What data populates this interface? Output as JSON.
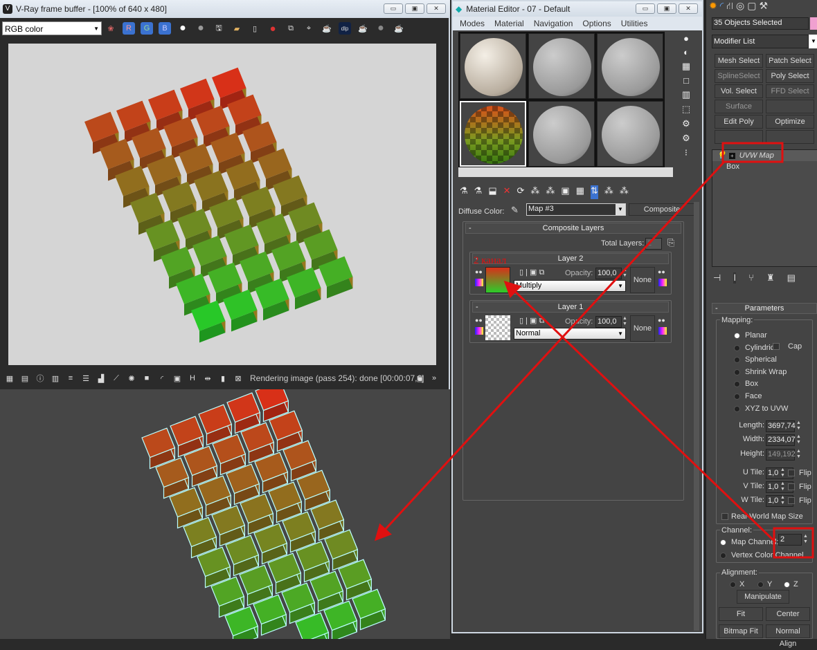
{
  "vfb": {
    "title": "V-Ray frame buffer - [100% of 640 x 480]",
    "channel_select": "RGB color",
    "channel_buttons": [
      "R",
      "G",
      "B"
    ],
    "status": "Rendering image (pass 254): done [00:00:07,6]"
  },
  "mat_editor": {
    "title": "Material Editor - 07 - Default",
    "menu": [
      "Modes",
      "Material",
      "Navigation",
      "Options",
      "Utilities"
    ],
    "diffuse_label": "Diffuse Color:",
    "map_name": "Map #3",
    "map_type": "Composite",
    "rollout_title": "Composite Layers",
    "total_layers_label": "Total Layers:",
    "total_layers": "2",
    "layers": [
      {
        "title": "Layer 2",
        "opacity_label": "Opacity:",
        "opacity": "100,0",
        "blend": "Multiply",
        "mask": "None"
      },
      {
        "title": "Layer 1",
        "opacity_label": "Opacity:",
        "opacity": "100,0",
        "blend": "Normal",
        "mask": "None"
      }
    ]
  },
  "annotation": {
    "text": "2 канал",
    "color": "#e01010"
  },
  "command_panel": {
    "selection": "35 Objects Selected",
    "modifier_list": "Modifier List",
    "modifier_buttons": [
      "Mesh Select",
      "Patch Select",
      "SplineSelect",
      "Poly Select",
      "Vol. Select",
      "FFD Select",
      "Surface Select",
      "",
      "Edit Poly",
      "Optimize",
      "",
      ""
    ],
    "stack": [
      "UVW Map",
      "Box"
    ],
    "parameters_title": "Parameters",
    "mapping_label": "Mapping:",
    "mapping_options": [
      "Planar",
      "Cylindrical",
      "Spherical",
      "Shrink Wrap",
      "Box",
      "Face",
      "XYZ to UVW"
    ],
    "mapping_selected": "Planar",
    "cap_label": "Cap",
    "length_label": "Length:",
    "length": "3697,74",
    "width_label": "Width:",
    "width": "2334,07",
    "height_label": "Height:",
    "height": "149,192",
    "u_tile_label": "U Tile:",
    "u_tile": "1,0",
    "v_tile_label": "V Tile:",
    "v_tile": "1,0",
    "w_tile_label": "W Tile:",
    "w_tile": "1,0",
    "flip_label": "Flip",
    "real_world": "Real-World Map Size",
    "channel_label": "Channel:",
    "map_channel_label": "Map Channel:",
    "map_channel": "2",
    "vertex_color_label": "Vertex Color Channel",
    "alignment_label": "Alignment:",
    "axes": [
      "X",
      "Y",
      "Z"
    ],
    "axis_selected": "Z",
    "manipulate": "Manipulate",
    "fit": "Fit",
    "center": "Center",
    "bitmap_fit": "Bitmap Fit",
    "normal_align": "Normal Align"
  }
}
